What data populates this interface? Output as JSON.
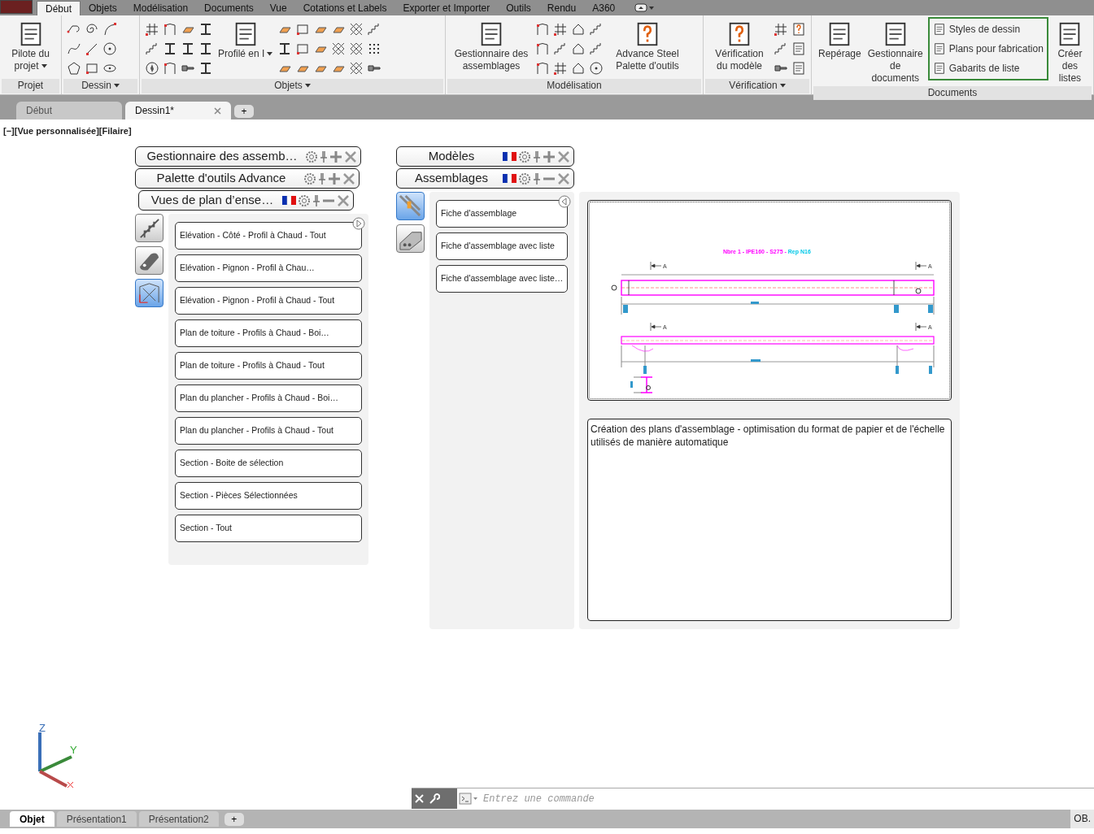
{
  "ribbon_tabs": [
    {
      "label": "Début",
      "selected": true
    },
    {
      "label": "Objets",
      "selected": false
    },
    {
      "label": "Modélisation",
      "selected": false
    },
    {
      "label": "Documents",
      "selected": false
    },
    {
      "label": "Vue",
      "selected": false
    },
    {
      "label": "Cotations et Labels",
      "selected": false
    },
    {
      "label": "Exporter et Importer",
      "selected": false
    },
    {
      "label": "Outils",
      "selected": false
    },
    {
      "label": "Rendu",
      "selected": false
    },
    {
      "label": "A360",
      "selected": false
    }
  ],
  "ribbon_groups": [
    {
      "label": "Projet",
      "dropdown": false,
      "buttons": [
        {
          "kind": "large",
          "label": "Pilote du projet",
          "caret": true
        }
      ]
    },
    {
      "label": "Dessin",
      "dropdown": true
    },
    {
      "label": "Objets",
      "dropdown": true,
      "buttons": [
        {
          "kind": "large",
          "label": "Profilé en I",
          "caret": true
        }
      ]
    },
    {
      "label": "Modélisation",
      "dropdown": false,
      "buttons": [
        {
          "kind": "large",
          "label": "Gestionnaire des assemblages",
          "caret": false
        },
        {
          "kind": "large",
          "label": "Advance Steel Palette d'outils",
          "caret": false
        }
      ]
    },
    {
      "label": "Vérification",
      "dropdown": true,
      "buttons": [
        {
          "kind": "large",
          "label": "Vérification du modèle",
          "caret": false
        }
      ]
    },
    {
      "label": "Documents",
      "dropdown": false,
      "buttons": [
        {
          "kind": "large",
          "label": "Repérage",
          "caret": false
        },
        {
          "kind": "large",
          "label": "Gestionnaire de documents",
          "caret": false
        },
        {
          "kind": "stack",
          "highlighted": true,
          "items": [
            "Styles de dessin",
            "Plans pour fabrication",
            "Gabarits de liste"
          ]
        },
        {
          "kind": "large",
          "label": "Créer des listes",
          "caret": false
        }
      ]
    }
  ],
  "file_tabs": [
    {
      "label": "Début",
      "selected": false,
      "closable": false
    },
    {
      "label": "Dessin1*",
      "selected": true,
      "closable": true
    }
  ],
  "viewport_label": "[−][Vue personnalisée][Filaire]",
  "left_palette": {
    "title_bars": [
      {
        "title": "Gestionnaire des assemb…",
        "flag": false,
        "expanded": false
      },
      {
        "title": "Palette d'outils Advance",
        "flag": false,
        "expanded": false
      },
      {
        "title": "Vues de plan d’ense…",
        "flag": true,
        "expanded": true
      }
    ],
    "side_tabs": [
      {
        "selected": false
      },
      {
        "selected": false
      },
      {
        "selected": true
      }
    ],
    "items": [
      "Elévation - Côté - Profil à Chaud - Tout",
      "Elévation - Pignon - Profil à Chau…",
      "Elévation - Pignon - Profil à Chaud - Tout",
      "Plan de toiture - Profils à Chaud - Boi…",
      "Plan de toiture - Profils à Chaud - Tout",
      "Plan du plancher - Profils à Chaud - Boi…",
      "Plan du plancher - Profils à Chaud - Tout",
      "Section - Boite de sélection",
      "Section - Pièces Sélectionnées",
      "Section - Tout"
    ]
  },
  "right_palette": {
    "title_bars": [
      {
        "title": "Modèles",
        "flag": true,
        "expanded": false
      },
      {
        "title": "Assemblages",
        "flag": true,
        "expanded": true
      }
    ],
    "side_tabs": [
      {
        "selected": true
      },
      {
        "selected": false
      }
    ],
    "items": [
      "Fiche d'assemblage",
      "Fiche d'assemblage avec liste",
      "Fiche d'assemblage avec liste…"
    ],
    "preview": {
      "title_parts": [
        "Nbre 1 - IPE160  - S275 - ",
        "Rep N16"
      ],
      "section_labels": [
        "A",
        "A",
        "A",
        "A"
      ]
    },
    "description": "Création des plans d'assemblage - optimisation du format de papier et de l'échelle utilisés de manière automatique"
  },
  "ucs": {
    "z": "Z",
    "y": "Y"
  },
  "command_line": {
    "placeholder": "Entrez une commande"
  },
  "layout_tabs": [
    {
      "label": "Objet",
      "selected": true
    },
    {
      "label": "Présentation1",
      "selected": false
    },
    {
      "label": "Présentation2",
      "selected": false
    }
  ],
  "add_tab": "+",
  "status": "OB."
}
